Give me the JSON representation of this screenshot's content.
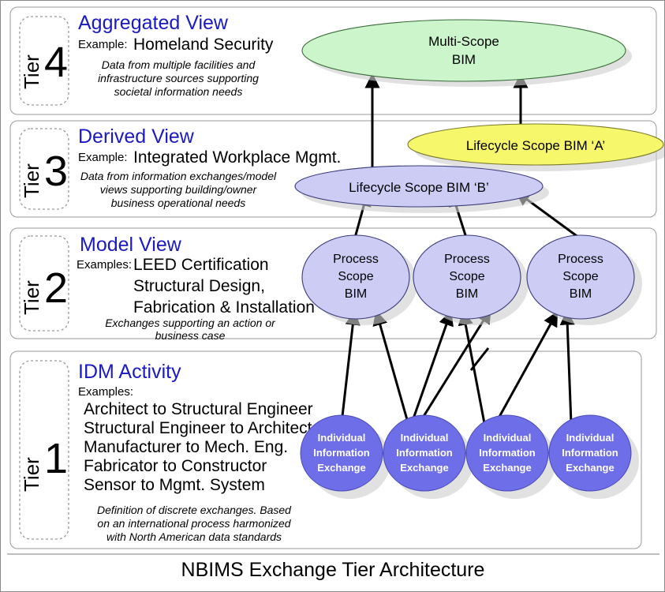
{
  "figure": {
    "caption": "NBIMS Exchange Tier Architecture",
    "background": "#ffffff",
    "border_color": "#8a8a8a"
  },
  "colors": {
    "heading_blue": "#1a1ac0",
    "multi_scope_green": "#ccf5cc",
    "lifecycle_a_yellow": "#f7f76b",
    "lifecycle_b_lavender": "#ccccf5",
    "process_scope_lavender": "#ccccf5",
    "individual_exchange_blue": "#6e6ee8",
    "shadow_gray": "#cfcfcf",
    "panel_border": "#9a9a9a",
    "arrow_black": "#000000"
  },
  "tiers": [
    {
      "tier_word": "Tier",
      "tier_number": "4",
      "heading": "Aggregated View",
      "example_label": "Example:",
      "example_value": "Homeland Security",
      "description": [
        "Data from multiple facilities and",
        "infrastructure sources supporting",
        "societal information needs"
      ]
    },
    {
      "tier_word": "Tier",
      "tier_number": "3",
      "heading": "Derived View",
      "example_label": "Example:",
      "example_value": "Integrated Workplace Mgmt.",
      "description": [
        "Data from information exchanges/model",
        "views supporting building/owner",
        "business operational needs"
      ]
    },
    {
      "tier_word": "Tier",
      "tier_number": "2",
      "heading": "Model View",
      "example_label": "Examples:",
      "example_values": [
        "LEED Certification",
        "Structural Design,",
        "Fabrication & Installation"
      ],
      "description": [
        "Exchanges supporting an action or",
        "business case"
      ]
    },
    {
      "tier_word": "Tier",
      "tier_number": "1",
      "heading": "IDM Activity",
      "example_label": "Examples:",
      "example_values": [
        "Architect to Structural Engineer",
        "Structural Engineer to Architect",
        "Manufacturer to Mech. Eng.",
        "Fabricator to Constructor",
        "Sensor to Mgmt. System"
      ],
      "description": [
        "Definition of discrete exchanges.  Based",
        "on an international process harmonized",
        "with North American data standards"
      ]
    }
  ],
  "nodes": {
    "multi_scope": {
      "line1": "Multi-Scope",
      "line2": "BIM"
    },
    "lifecycle_a": {
      "label": "Lifecycle Scope BIM ‘A’"
    },
    "lifecycle_b": {
      "label": "Lifecycle Scope BIM ‘B’"
    },
    "process_scope": [
      {
        "line1": "Process",
        "line2": "Scope",
        "line3": "BIM"
      },
      {
        "line1": "Process",
        "line2": "Scope",
        "line3": "BIM"
      },
      {
        "line1": "Process",
        "line2": "Scope",
        "line3": "BIM"
      }
    ],
    "individual_exchange": [
      {
        "line1": "Individual",
        "line2": "Information",
        "line3": "Exchange"
      },
      {
        "line1": "Individual",
        "line2": "Information",
        "line3": "Exchange"
      },
      {
        "line1": "Individual",
        "line2": "Information",
        "line3": "Exchange"
      },
      {
        "line1": "Individual",
        "line2": "Information",
        "line3": "Exchange"
      }
    ]
  }
}
